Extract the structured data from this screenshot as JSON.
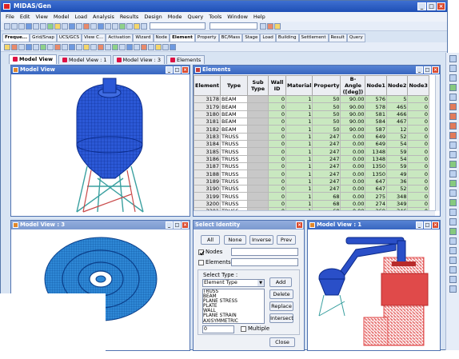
{
  "app": {
    "title": "MIDAS/Gen"
  },
  "menu": [
    "File",
    "Edit",
    "View",
    "Model",
    "Load",
    "Analysis",
    "Results",
    "Design",
    "Mode",
    "Query",
    "Tools",
    "Window",
    "Help"
  ],
  "toolbar_tabs": [
    {
      "label": "Freque...",
      "active": true
    },
    {
      "label": "Grid/Snap",
      "active": false
    },
    {
      "label": "UCS/GCS",
      "active": false
    },
    {
      "label": "View C...",
      "active": false
    },
    {
      "label": "Activation",
      "active": false
    },
    {
      "label": "Wizard",
      "active": false
    },
    {
      "label": "Node",
      "active": false
    },
    {
      "label": "Element",
      "active": true
    },
    {
      "label": "Property",
      "active": false
    },
    {
      "label": "BC/Mass",
      "active": false
    },
    {
      "label": "Stage",
      "active": false
    },
    {
      "label": "Load",
      "active": false
    },
    {
      "label": "Building",
      "active": false
    },
    {
      "label": "Settlement",
      "active": false
    },
    {
      "label": "Result",
      "active": false
    },
    {
      "label": "Query",
      "active": false
    }
  ],
  "doc_tabs": [
    {
      "label": "Model View",
      "active": true
    },
    {
      "label": "Model View : 1",
      "active": false
    },
    {
      "label": "Model View : 3",
      "active": false
    },
    {
      "label": "Elements",
      "active": false
    }
  ],
  "panes": {
    "model_view": {
      "title": "Model View"
    },
    "elements": {
      "title": "Elements"
    },
    "model_view_3": {
      "title": "Model View : 3"
    },
    "select_identity": {
      "title": "Select Identity"
    },
    "model_view_1": {
      "title": "Model View : 1"
    }
  },
  "elements_table": {
    "columns": [
      "Element",
      "Type",
      "Sub Type",
      "Wall ID",
      "Material",
      "Property",
      "B-Angle ([deg])",
      "Node1",
      "Node2",
      "Node3"
    ],
    "rows": [
      [
        "3178",
        "BEAM",
        "",
        "0",
        "1",
        "50",
        "90.00",
        "576",
        "5",
        "0"
      ],
      [
        "3179",
        "BEAM",
        "",
        "0",
        "1",
        "50",
        "90.00",
        "578",
        "465",
        "0"
      ],
      [
        "3180",
        "BEAM",
        "",
        "0",
        "1",
        "50",
        "90.00",
        "581",
        "466",
        "0"
      ],
      [
        "3181",
        "BEAM",
        "",
        "0",
        "1",
        "50",
        "90.00",
        "584",
        "467",
        "0"
      ],
      [
        "3182",
        "BEAM",
        "",
        "0",
        "1",
        "50",
        "90.00",
        "587",
        "12",
        "0"
      ],
      [
        "3183",
        "TRUSS",
        "",
        "0",
        "1",
        "247",
        "0.00",
        "649",
        "52",
        "0"
      ],
      [
        "3184",
        "TRUSS",
        "",
        "0",
        "1",
        "247",
        "0.00",
        "649",
        "54",
        "0"
      ],
      [
        "3185",
        "TRUSS",
        "",
        "0",
        "1",
        "247",
        "0.00",
        "1348",
        "59",
        "0"
      ],
      [
        "3186",
        "TRUSS",
        "",
        "0",
        "1",
        "247",
        "0.00",
        "1348",
        "54",
        "0"
      ],
      [
        "3187",
        "TRUSS",
        "",
        "0",
        "1",
        "247",
        "0.00",
        "1350",
        "59",
        "0"
      ],
      [
        "3188",
        "TRUSS",
        "",
        "0",
        "1",
        "247",
        "0.00",
        "1350",
        "49",
        "0"
      ],
      [
        "3189",
        "TRUSS",
        "",
        "0",
        "1",
        "247",
        "0.00",
        "647",
        "36",
        "0"
      ],
      [
        "3190",
        "TRUSS",
        "",
        "0",
        "1",
        "247",
        "0.00",
        "647",
        "52",
        "0"
      ],
      [
        "3199",
        "TRUSS",
        "",
        "0",
        "1",
        "68",
        "0.00",
        "275",
        "348",
        "0"
      ],
      [
        "3200",
        "TRUSS",
        "",
        "0",
        "1",
        "68",
        "0.00",
        "274",
        "349",
        "0"
      ],
      [
        "3201",
        "TRUSS",
        "",
        "0",
        "1",
        "68",
        "0.00",
        "269",
        "346",
        "0"
      ]
    ]
  },
  "select_identity": {
    "buttons_top": [
      "All",
      "None",
      "Inverse",
      "Prev"
    ],
    "nodes_label": "Nodes",
    "elements_label": "Elements",
    "select_type_label": "Select Type :",
    "select_type_value": "Element Type",
    "type_options": [
      "TRUSS",
      "BEAM",
      "PLANE STRESS",
      "PLATE",
      "WALL",
      "PLANE STRAIN",
      "AXISYMMETRIC"
    ],
    "add": "Add",
    "delete": "Delete",
    "replace": "Replace",
    "intersect": "Intersect",
    "value": "0",
    "multiple_label": "Multiple",
    "close": "Close"
  },
  "colors": {
    "title_active": "#3866c0",
    "grid_cell": "#c9e8c0",
    "model_blue": "#2a5fd8",
    "truss_red": "#e04a4a"
  }
}
